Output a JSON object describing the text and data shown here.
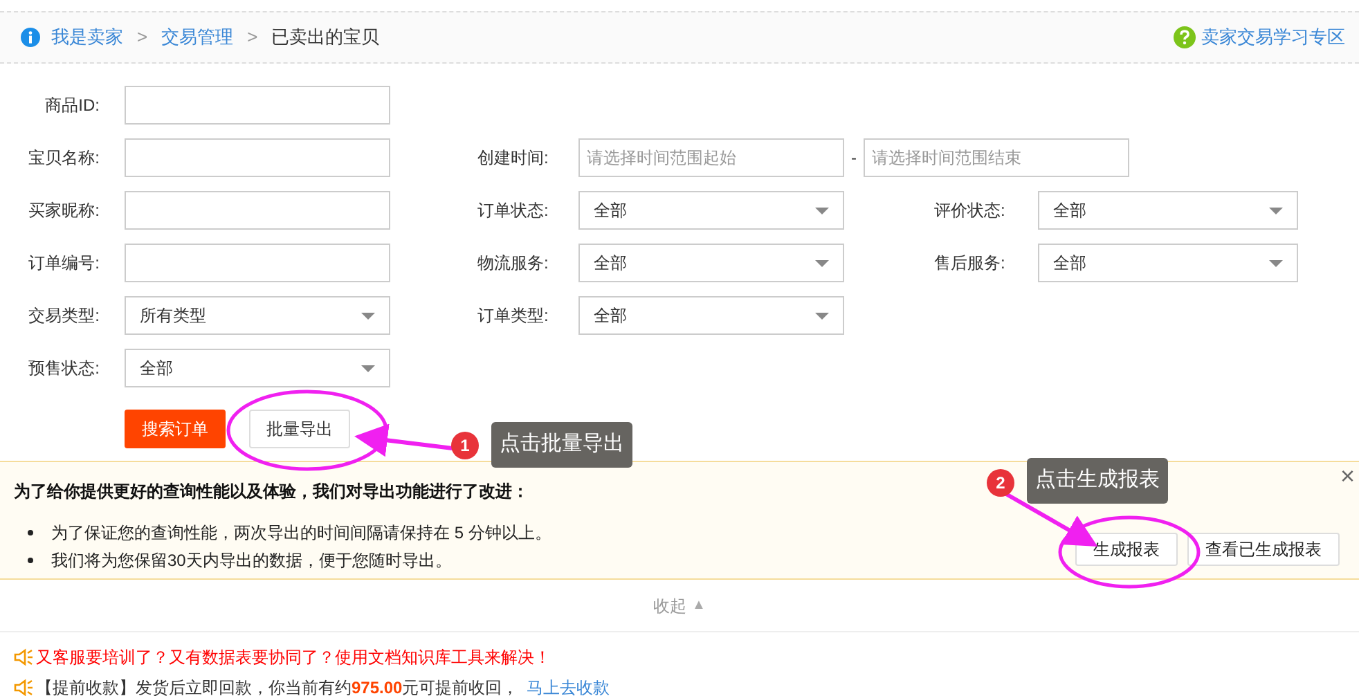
{
  "breadcrumb": [
    {
      "label": "我是卖家",
      "kind": "link"
    },
    {
      "label": "交易管理",
      "kind": "link"
    },
    {
      "label": "已卖出的宝贝",
      "kind": "current"
    }
  ],
  "breadcrumb_separator": ">",
  "help_link": "卖家交易学习专区",
  "form_columns": [
    [
      {
        "label": "商品ID:",
        "kind": "text"
      },
      {
        "label": "宝贝名称:",
        "kind": "text"
      },
      {
        "label": "买家昵称:",
        "kind": "text"
      },
      {
        "label": "订单编号:",
        "kind": "text"
      },
      {
        "label": "交易类型:",
        "kind": "select",
        "value": "所有类型"
      },
      {
        "label": "预售状态:",
        "kind": "select",
        "value": "全部"
      }
    ],
    [
      {
        "label": "创建时间:",
        "kind": "daterange",
        "start_placeholder": "请选择时间范围起始",
        "separator": "-",
        "end_placeholder": "请选择时间范围结束"
      },
      {
        "label": "订单状态:",
        "kind": "select",
        "value": "全部"
      },
      {
        "label": "物流服务:",
        "kind": "select",
        "value": "全部"
      },
      {
        "label": "订单类型:",
        "kind": "select",
        "value": "全部"
      }
    ],
    [
      {
        "label": "评价状态:",
        "kind": "select",
        "value": "全部"
      },
      {
        "label": "售后服务:",
        "kind": "select",
        "value": "全部"
      }
    ]
  ],
  "actions": [
    {
      "label": "搜索订单",
      "kind": "primary"
    },
    {
      "label": "批量导出",
      "kind": "secondary"
    }
  ],
  "notice": {
    "title": "为了给你提供更好的查询性能以及体验，我们对导出功能进行了改进：",
    "bullets": [
      "为了保证您的查询性能，两次导出的时间间隔请保持在 5 分钟以上。",
      "我们将为您保留30天内导出的数据，便于您随时导出。"
    ],
    "buttons": [
      "生成报表",
      "查看已生成报表"
    ],
    "close": "×"
  },
  "collapse": {
    "label": "收起",
    "arrow": "▲"
  },
  "promos": [
    {
      "text": "又客服要培训了？又有数据表要协同了？使用文档知识库工具来解决！",
      "kind": "alert"
    },
    {
      "text": "【提前收款】发货后立即回款，你当前有约",
      "amount": "975.00",
      "after": "元可提前收回，",
      "link": "马上去收款",
      "kind": "info"
    }
  ],
  "callouts": [
    {
      "number": "1",
      "text": "点击批量导出"
    },
    {
      "number": "2",
      "text": "点击生成报表"
    }
  ]
}
